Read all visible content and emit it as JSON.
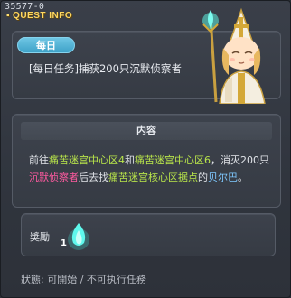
{
  "window": {
    "quest_id": "35577-0",
    "title": "QUEST INFO"
  },
  "quest": {
    "badge": "每日",
    "name": "[每日任务]捕获200只沉默侦察者"
  },
  "content": {
    "header": "内容",
    "desc_parts": [
      {
        "text": "前往",
        "style": "normal"
      },
      {
        "text": "痛苦迷宫中心区4",
        "style": "green"
      },
      {
        "text": "和",
        "style": "normal"
      },
      {
        "text": "痛苦迷宫中心区6",
        "style": "green"
      },
      {
        "text": "，消灭200只",
        "style": "normal"
      },
      {
        "text": "沉默侦察者",
        "style": "pink"
      },
      {
        "text": "后去找",
        "style": "normal"
      },
      {
        "text": "痛苦迷宫核心区据点",
        "style": "green"
      },
      {
        "text": "的",
        "style": "normal"
      },
      {
        "text": "贝尔巴",
        "style": "blue"
      },
      {
        "text": "。",
        "style": "normal"
      }
    ]
  },
  "reward": {
    "label": "獎勵",
    "item_icon": "blue-flame-icon",
    "item_count": "1"
  },
  "status": {
    "text": "狀態: 可開始 / 不可执行任務"
  },
  "colors": {
    "title": "#ffd860",
    "badge": "#4fb0d4",
    "highlight_green": "#b8e44a",
    "highlight_pink": "#ff5aa0",
    "highlight_blue": "#7ec8ff"
  }
}
